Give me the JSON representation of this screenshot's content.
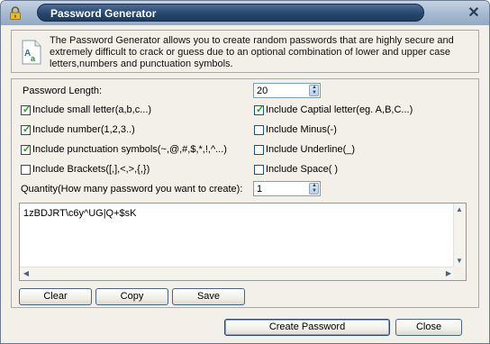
{
  "window": {
    "title": "Password Generator"
  },
  "info": {
    "text": "The Password Generator allows you to create random passwords that are highly secure and extremely difficult to crack or guess due to an optional combination of lower and upper case letters,numbers and punctuation symbols."
  },
  "options": {
    "length_label": "Password Length:",
    "length_value": "20",
    "small_letter": {
      "label": "Include small letter(a,b,c...)",
      "checked": true
    },
    "capital_letter": {
      "label": "Include Captial letter(eg. A,B,C...)",
      "checked": true
    },
    "number": {
      "label": "Include number(1,2,3..)",
      "checked": true
    },
    "minus": {
      "label": "Include Minus(-)",
      "checked": false
    },
    "punctuation": {
      "label": "Include punctuation symbols(~,@,#,$,*,!,^...)",
      "checked": true
    },
    "underline": {
      "label": "Include Underline(_)",
      "checked": false
    },
    "brackets": {
      "label": "Include Brackets([,],<,>,{,})",
      "checked": false
    },
    "space": {
      "label": "Include Space( )",
      "checked": false
    },
    "quantity_label": "Quantity(How many password you want to create):",
    "quantity_value": "1"
  },
  "output": {
    "text": "1zBDJRT\\c6y^UG|Q+$sK"
  },
  "buttons": {
    "clear": "Clear",
    "copy": "Copy",
    "save": "Save",
    "create": "Create Password",
    "close": "Close"
  },
  "icons": {
    "window": "lock-icon",
    "info": "document-text-icon",
    "close": "close-icon"
  },
  "colors": {
    "title_pill": "#27476f",
    "check_mark": "#21a121",
    "button_border": "#4a6487"
  }
}
